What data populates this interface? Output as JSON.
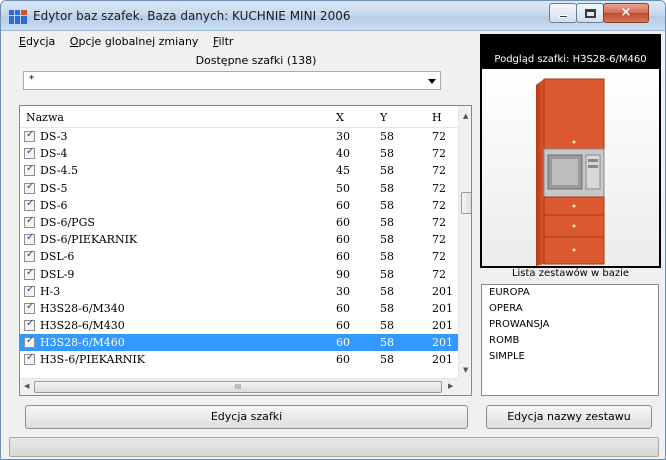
{
  "window": {
    "title": "Edytor baz szafek. Baza danych: KUCHNIE MINI 2006",
    "controls": {
      "minimize": "",
      "maximize": "",
      "close": "×"
    }
  },
  "menu": [
    {
      "label_pre": "",
      "label_ul": "E",
      "label_post": "dycja"
    },
    {
      "label_pre": "",
      "label_ul": "O",
      "label_post": "pcje globalnej zmiany"
    },
    {
      "label_pre": "",
      "label_ul": "F",
      "label_post": "iltr"
    }
  ],
  "available_label": "Dostępne szafki (138)",
  "filter": {
    "value": "*"
  },
  "table": {
    "columns": [
      "Nazwa",
      "X",
      "Y",
      "H"
    ],
    "rows": [
      {
        "name": "DS-3",
        "x": "30",
        "y": "58",
        "h": "72",
        "checked": true
      },
      {
        "name": "DS-4",
        "x": "40",
        "y": "58",
        "h": "72",
        "checked": true
      },
      {
        "name": "DS-4.5",
        "x": "45",
        "y": "58",
        "h": "72",
        "checked": true
      },
      {
        "name": "DS-5",
        "x": "50",
        "y": "58",
        "h": "72",
        "checked": true
      },
      {
        "name": "DS-6",
        "x": "60",
        "y": "58",
        "h": "72",
        "checked": true
      },
      {
        "name": "DS-6/PGS",
        "x": "60",
        "y": "58",
        "h": "72",
        "checked": true
      },
      {
        "name": "DS-6/PIEKARNIK",
        "x": "60",
        "y": "58",
        "h": "72",
        "checked": true
      },
      {
        "name": "DSL-6",
        "x": "60",
        "y": "58",
        "h": "72",
        "checked": true
      },
      {
        "name": "DSL-9",
        "x": "90",
        "y": "58",
        "h": "72",
        "checked": true
      },
      {
        "name": "H-3",
        "x": "30",
        "y": "58",
        "h": "201",
        "checked": true
      },
      {
        "name": "H3S28-6/M340",
        "x": "60",
        "y": "58",
        "h": "201",
        "checked": true
      },
      {
        "name": "H3S28-6/M430",
        "x": "60",
        "y": "58",
        "h": "201",
        "checked": true
      },
      {
        "name": "H3S28-6/M460",
        "x": "60",
        "y": "58",
        "h": "201",
        "checked": true,
        "selected": true
      },
      {
        "name": "H3S-6/PIEKARNIK",
        "x": "60",
        "y": "58",
        "h": "201",
        "checked": true
      }
    ],
    "hscroll_thumb_glyph": "III"
  },
  "buttons": {
    "edit_cabinet": "Edycja szafki",
    "edit_set_name": "Edycja nazwy zestawu"
  },
  "preview": {
    "title": "Podgląd szafki: H3S28-6/M460"
  },
  "sets": {
    "caption": "Lista zestawów w bazie",
    "items": [
      "EUROPA",
      "OPERA",
      "PROWANSJA",
      "ROMB",
      "SIMPLE"
    ]
  },
  "colors": {
    "selection": "#3399ff",
    "cabinet_front": "#d8532c",
    "microwave": "#b8b8b8"
  }
}
